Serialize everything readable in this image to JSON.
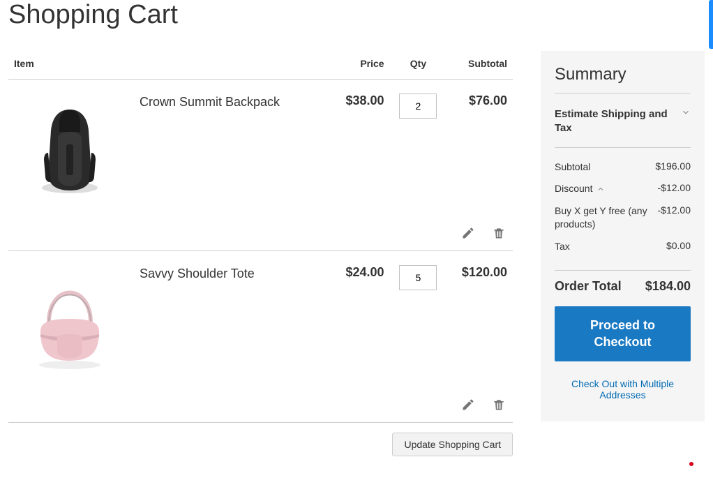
{
  "page": {
    "title": "Shopping Cart"
  },
  "columns": {
    "item": "Item",
    "price": "Price",
    "qty": "Qty",
    "subtotal": "Subtotal"
  },
  "items": [
    {
      "name": "Crown Summit Backpack",
      "price": "$38.00",
      "qty": "2",
      "subtotal": "$76.00",
      "image": "backpack"
    },
    {
      "name": "Savvy Shoulder Tote",
      "price": "$24.00",
      "qty": "5",
      "subtotal": "$120.00",
      "image": "tote"
    }
  ],
  "actions": {
    "update": "Update Shopping Cart"
  },
  "summary": {
    "title": "Summary",
    "estimate_label": "Estimate Shipping and Tax",
    "subtotal_label": "Subtotal",
    "subtotal_value": "$196.00",
    "discount_label": "Discount",
    "discount_value": "-$12.00",
    "discount_detail_label": "Buy X get Y free (any products)",
    "discount_detail_value": "-$12.00",
    "tax_label": "Tax",
    "tax_value": "$0.00",
    "order_total_label": "Order Total",
    "order_total_value": "$184.00",
    "checkout_button": "Proceed to Checkout",
    "multi_checkout": "Check Out with Multiple Addresses"
  }
}
